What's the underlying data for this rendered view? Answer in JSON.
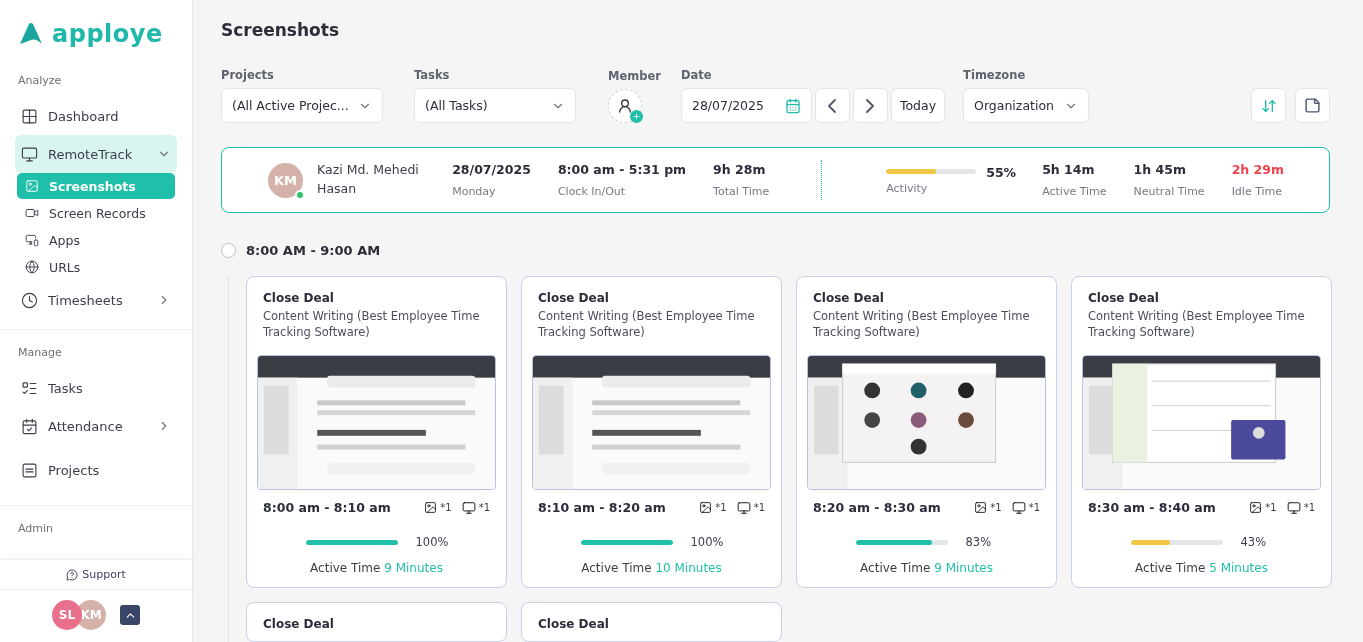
{
  "sidebar": {
    "logo": "apploye",
    "sections": [
      {
        "title": "Analyze",
        "items": [
          {
            "label": "Dashboard"
          },
          {
            "label": "RemoteTrack",
            "selected": true,
            "expanded": true,
            "children": [
              {
                "label": "Screenshots",
                "selected": true
              },
              {
                "label": "Screen Records",
                "selected": false
              },
              {
                "label": "Apps",
                "selected": false
              },
              {
                "label": "URLs",
                "selected": false
              }
            ]
          },
          {
            "label": "Timesheets",
            "expanded": false
          }
        ]
      },
      {
        "title": "Manage",
        "items": [
          {
            "label": "Tasks"
          },
          {
            "label": "Attendance",
            "expanded": false
          },
          {
            "label": "Projects"
          }
        ]
      },
      {
        "title": "Admin"
      }
    ],
    "support": "Support",
    "avatars": [
      {
        "initials": "SL",
        "color": "#e8708c"
      },
      {
        "initials": "KM",
        "color": "#d4b2aa"
      }
    ]
  },
  "page_title": "Screenshots",
  "filters": {
    "projects": {
      "label": "Projects",
      "value": "(All Active Projec..."
    },
    "tasks": {
      "label": "Tasks",
      "value": "(All Tasks)"
    },
    "member": {
      "label": "Member"
    },
    "date": {
      "label": "Date",
      "value": "28/07/2025",
      "today": "Today"
    },
    "timezone": {
      "label": "Timezone",
      "value": "Organization"
    }
  },
  "summary": {
    "initials": "KM",
    "online": true,
    "name": "Kazi Md. Mehedi Hasan",
    "info": [
      {
        "value": "28/07/2025",
        "label": "Monday"
      },
      {
        "value": "8:00 am - 5:31 pm",
        "label": "Clock In/Out"
      },
      {
        "value": "9h 28m",
        "label": "Total Time"
      }
    ],
    "activity": {
      "label": "Activity",
      "level": 0.55,
      "reading": "55%"
    },
    "stats": [
      {
        "value": "5h 14m",
        "label": "Active Time",
        "color": "#2b2d3a"
      },
      {
        "value": "1h 45m",
        "label": "Neutral Time",
        "color": "#2b2d3a"
      },
      {
        "value": "2h 29m",
        "label": "Idle Time",
        "color": "#f0454f"
      }
    ]
  },
  "slots": [
    {
      "title": "8:00 AM - 9:00 AM",
      "checked": false,
      "cards": [
        {
          "task": "Close Deal",
          "project": "Content Writing (Best Employee Time Tracking Software)",
          "time": "8:00 am - 8:10 am",
          "images": "*1",
          "screens": "*1",
          "level": 1,
          "reading": "100%",
          "active_label": "Active Time",
          "active_value": "9 Minutes"
        },
        {
          "task": "Close Deal",
          "project": "Content Writing (Best Employee Time Tracking Software)",
          "time": "8:10 am - 8:20 am",
          "images": "*1",
          "screens": "*1",
          "level": 1,
          "reading": "100%",
          "active_label": "Active Time",
          "active_value": "10 Minutes"
        },
        {
          "task": "Close Deal",
          "project": "Content Writing (Best Employee Time Tracking Software)",
          "time": "8:20 am - 8:30 am",
          "images": "*1",
          "screens": "*1",
          "level": 0.83,
          "reading": "83%",
          "active_label": "Active Time",
          "active_value": "9 Minutes"
        },
        {
          "task": "Close Deal",
          "project": "Content Writing (Best Employee Time Tracking Software)",
          "time": "8:30 am - 8:40 am",
          "images": "*1",
          "screens": "*1",
          "level": 0.43,
          "reading": "43%",
          "active_label": "Active Time",
          "active_value": "5 Minutes"
        },
        {
          "task": "Close Deal"
        },
        {
          "task": "Close Deal"
        }
      ]
    }
  ]
}
